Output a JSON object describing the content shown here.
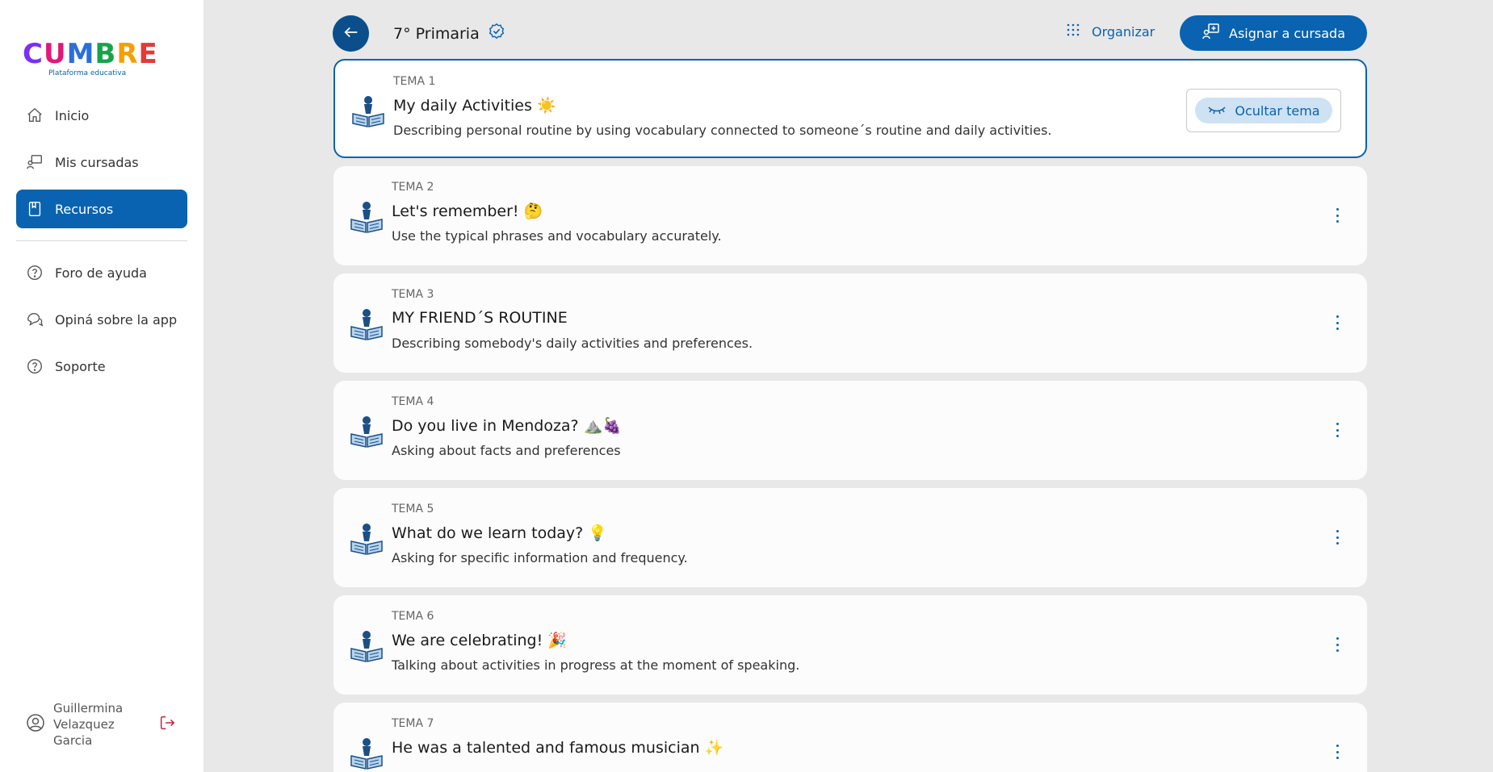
{
  "sidebar": {
    "logo": {
      "letters": [
        "C",
        "U",
        "M",
        "B",
        "R",
        "E"
      ],
      "letter_colors": [
        "#7b2ff7",
        "#e4167a",
        "#2a6fdb",
        "#17a34a",
        "#f5a000",
        "#e53935"
      ],
      "subtitle": "Plataforma educativa"
    },
    "nav": [
      {
        "label": "Inicio",
        "icon": "home-icon"
      },
      {
        "label": "Mis cursadas",
        "icon": "teacher-board-icon"
      },
      {
        "label": "Recursos",
        "icon": "book-icon",
        "active": true
      }
    ],
    "secondary": [
      {
        "label": "Foro de ayuda",
        "icon": "help-circle-icon"
      },
      {
        "label": "Opiná sobre la app",
        "icon": "chat-bubbles-icon"
      },
      {
        "label": "Soporte",
        "icon": "help-circle-icon"
      }
    ],
    "user": {
      "name": "Guillermina Velazquez Garcia"
    }
  },
  "header": {
    "course_title": "7° Primaria",
    "organize_label": "Organizar",
    "assign_label": "Asignar a cursada"
  },
  "topics": [
    {
      "tema": "TEMA 1",
      "title": "My daily Activities ☀️",
      "description": "Describing personal routine by using vocabulary connected to someone´s routine and daily activities.",
      "selected": true,
      "hide_label": "Ocultar tema"
    },
    {
      "tema": "TEMA 2",
      "title": "Let's remember! 🤔",
      "description": "Use the typical phrases and vocabulary accurately."
    },
    {
      "tema": "TEMA 3",
      "title": "MY FRIEND´S ROUTINE",
      "description": "Describing somebody's daily activities and preferences."
    },
    {
      "tema": "TEMA 4",
      "title": "Do you live in Mendoza? ⛰️🍇",
      "description": "Asking about facts and preferences"
    },
    {
      "tema": "TEMA 5",
      "title": "What do we learn today? 💡",
      "description": "Asking for specific information and frequency."
    },
    {
      "tema": "TEMA 6",
      "title": "We are celebrating! 🎉",
      "description": "Talking about activities in progress at the moment of speaking."
    },
    {
      "tema": "TEMA 7",
      "title": "He was a talented and famous musician ✨",
      "description": ""
    }
  ],
  "colors": {
    "primary": "#0a63b0",
    "dark_primary": "#0a4f8c",
    "background": "#e8e8e8"
  }
}
